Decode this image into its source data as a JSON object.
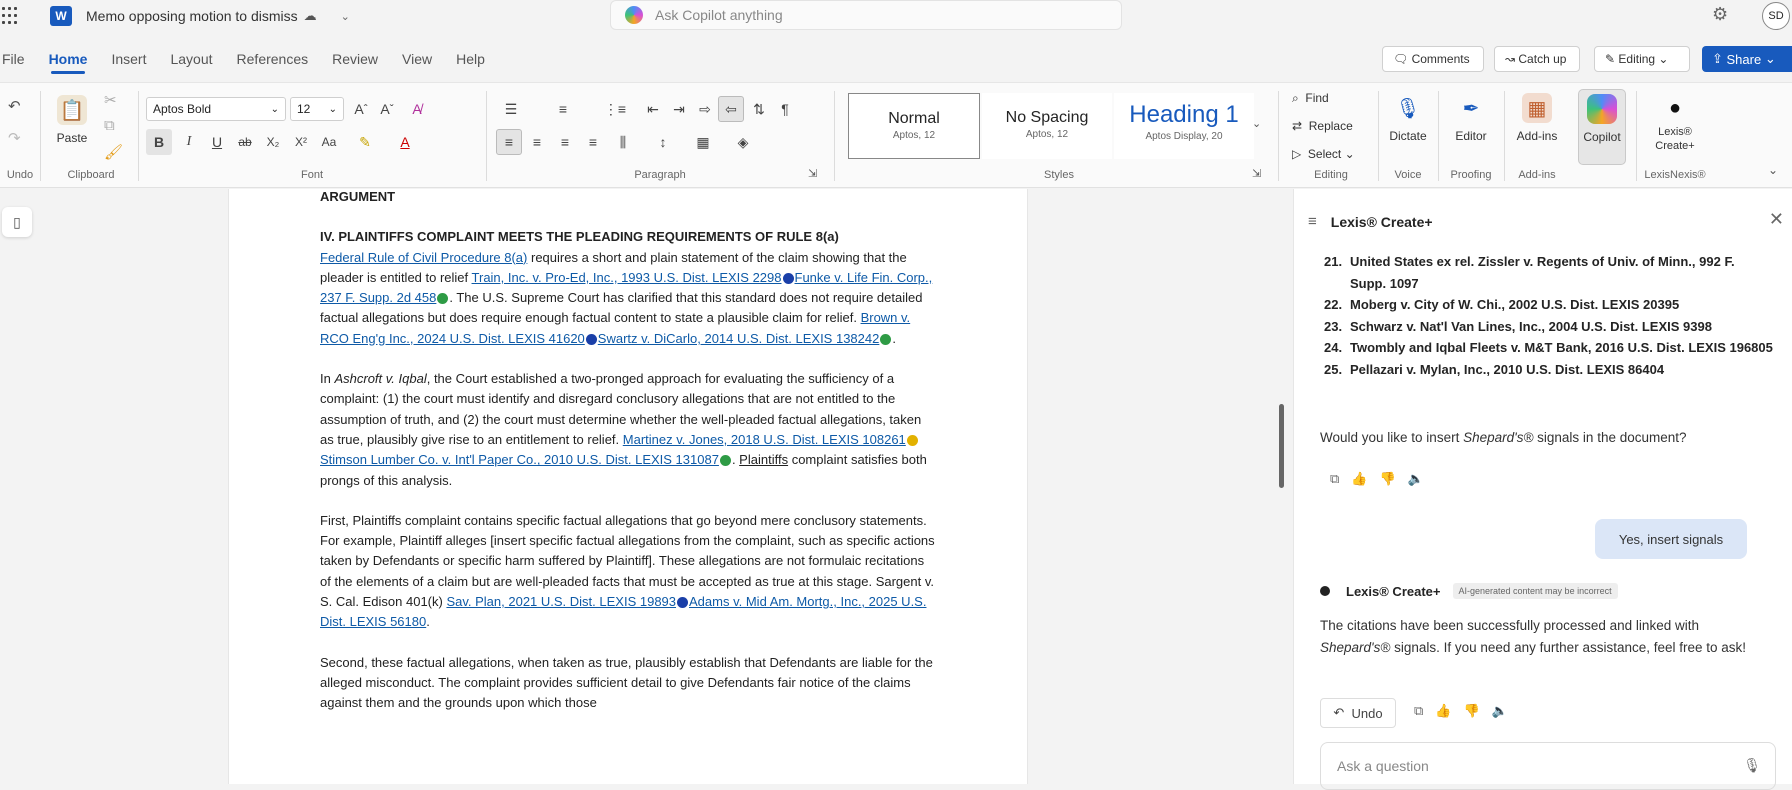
{
  "titlebar": {
    "doc_title": "Memo opposing motion to dismiss",
    "search_placeholder": "Ask Copilot anything",
    "avatar": "SD"
  },
  "tabs": [
    "File",
    "Home",
    "Insert",
    "Layout",
    "References",
    "Review",
    "View",
    "Help"
  ],
  "toolbar": {
    "comments": "Comments",
    "catchup": "Catch up",
    "editing": "Editing",
    "share": "Share"
  },
  "ribbon": {
    "undo_label": "Undo",
    "clipboard": {
      "paste": "Paste",
      "label": "Clipboard"
    },
    "font": {
      "name": "Aptos Bold",
      "size": "12",
      "label": "Font"
    },
    "paragraph_label": "Paragraph",
    "styles": [
      {
        "name": "Normal",
        "sub": "Aptos, 12"
      },
      {
        "name": "No Spacing",
        "sub": "Aptos, 12"
      },
      {
        "name": "Heading 1",
        "sub": "Aptos Display, 20"
      }
    ],
    "styles_label": "Styles",
    "editing": {
      "find": "Find",
      "replace": "Replace",
      "select": "Select",
      "label": "Editing"
    },
    "voice": {
      "dictate": "Dictate",
      "label": "Voice"
    },
    "proofing": {
      "editor": "Editor",
      "label": "Proofing"
    },
    "addins": {
      "btn": "Add-ins",
      "label": "Add-ins"
    },
    "copilot": "Copilot",
    "lexis": {
      "btn1": "Lexis®",
      "btn2": "Create+",
      "label": "LexisNexis®"
    }
  },
  "doc": {
    "heading": "ARGUMENT",
    "subheading": "IV. PLAINTIFFS COMPLAINT MEETS THE PLEADING REQUIREMENTS OF RULE 8(a)",
    "p1": {
      "l1": "Federal Rule of Civil Procedure 8(a)",
      "t1": " requires a short and plain statement of the claim showing that the pleader is entitled to relief ",
      "l2": "Train, Inc. v. Pro-Ed, Inc., 1993 U.S. Dist. LEXIS 2298",
      "l3": "Funke v. Life Fin. Corp., 237 F. Supp. 2d 458",
      "t2": ". The U.S. Supreme Court has clarified that this standard does not require detailed factual allegations but does require enough factual content to state a plausible claim for relief. ",
      "l4": "Brown v. RCO Eng'g Inc., 2024 U.S. Dist. LEXIS 41620",
      "l5": "Swartz v. DiCarlo, 2014 U.S. Dist. LEXIS 138242",
      "t3": "."
    },
    "p2": {
      "t0": "In ",
      "i1": "Ashcroft v. Iqbal",
      "t1": ", the Court established a two-pronged approach for evaluating the sufficiency of a complaint: (1) the court must identify and disregard conclusory allegations that are not entitled to the assumption of truth, and (2) the court must determine whether the well-pleaded factual allegations, taken as true, plausibly give rise to an entitlement to relief. ",
      "l1": "Martinez v. Jones, 2018 U.S. Dist. LEXIS 108261",
      "l2": "Stimson Lumber Co. v. Int'l Paper Co., 2010 U.S. Dist. LEXIS 131087",
      "t2": ". ",
      "u1": "Plaintiffs",
      "t3": " complaint satisfies both prongs of this analysis."
    },
    "p3": {
      "t1": "First, Plaintiffs complaint contains specific factual allegations that go beyond mere conclusory statements. For example, Plaintiff alleges [insert specific factual allegations from the complaint, such as specific actions taken by Defendants or specific harm suffered by Plaintiff]. These allegations are not formulaic recitations of the elements of a claim but are well-pleaded facts that must be accepted as true at this stage. Sargent v. S. Cal. Edison 401(k) ",
      "l1": "Sav. Plan, 2021 U.S. Dist. LEXIS 19893",
      "l2": "Adams v. Mid Am. Mortg., Inc., 2025 U.S. Dist. LEXIS 56180",
      "t2": "."
    },
    "p4": "Second, these factual allegations, when taken as true, plausibly establish that Defendants are liable for the alleged misconduct. The complaint provides sufficient detail to give Defendants fair notice of the claims against them and the grounds upon which those"
  },
  "pane": {
    "title": "Lexis® Create+",
    "citations": [
      {
        "n": "21.",
        "t": "United States ex rel. Zissler v. Regents of Univ. of Minn., 992 F. Supp. 1097"
      },
      {
        "n": "22.",
        "t": "Moberg v. City of W. Chi., 2002 U.S. Dist. LEXIS 20395"
      },
      {
        "n": "23.",
        "t": "Schwarz v. Nat'l Van Lines, Inc., 2004 U.S. Dist. LEXIS 9398"
      },
      {
        "n": "24.",
        "t": "Twombly and Iqbal Fleets v. M&T Bank, 2016 U.S. Dist. LEXIS 196805"
      },
      {
        "n": "25.",
        "t": "Pellazari v. Mylan, Inc., 2010 U.S. Dist. LEXIS 86404"
      }
    ],
    "question": {
      "t1": "Would you like to insert ",
      "i": "Shepard's®",
      "t2": " signals in the document?"
    },
    "user_reply": "Yes, insert signals",
    "bot_name": "Lexis® Create+",
    "ai_badge": "AI-generated content may be incorrect",
    "answer": {
      "t1": "The citations have been successfully processed and linked with ",
      "i": "Shepard's®",
      "t2": " signals. If you need any further assistance, feel free to ask!"
    },
    "undo": "Undo",
    "ask_placeholder": "Ask a question"
  }
}
